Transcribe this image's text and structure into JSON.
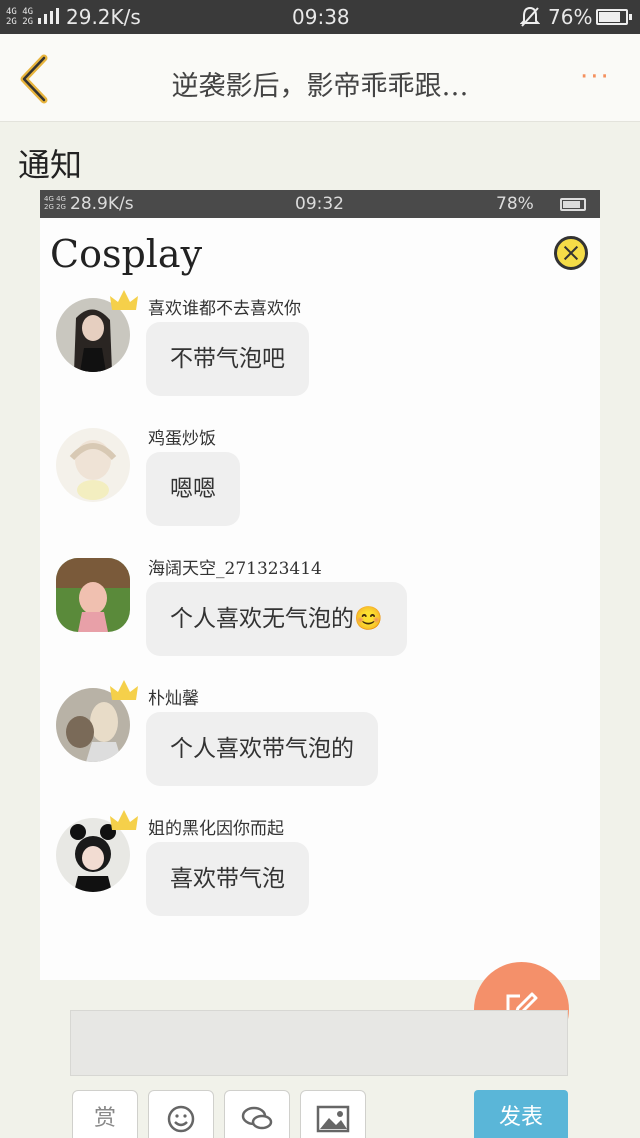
{
  "status_bar": {
    "network": "4G 4G\n2G 2G",
    "speed": "29.2K/s",
    "time": "09:38",
    "battery": "76%"
  },
  "nav": {
    "title": "逆袭影后，影帝乖乖跟…",
    "more": "···"
  },
  "section_title": "通知",
  "embedded": {
    "status_bar": {
      "network": "4G 4G\n2G 2G",
      "speed": "28.9K/s",
      "time": "09:32",
      "battery": "78%"
    },
    "title": "Cosplay",
    "messages": [
      {
        "name": "喜欢谁都不去喜欢你",
        "text": "不带气泡吧",
        "crown": true
      },
      {
        "name": "鸡蛋炒饭",
        "text": "嗯嗯",
        "crown": false
      },
      {
        "name": "海阔天空_271323414",
        "text": "个人喜欢无气泡的😊",
        "crown": false
      },
      {
        "name": "朴灿馨",
        "text": "个人喜欢带气泡的",
        "crown": true
      },
      {
        "name": "姐的黑化因你而起",
        "text": "喜欢带气泡",
        "crown": true
      }
    ]
  },
  "toolbar": {
    "reward_label": "赏",
    "post_label": "发表"
  },
  "colors": {
    "accent": "#f4906a",
    "post": "#5ab6d8",
    "crown": "#f5d04a"
  }
}
